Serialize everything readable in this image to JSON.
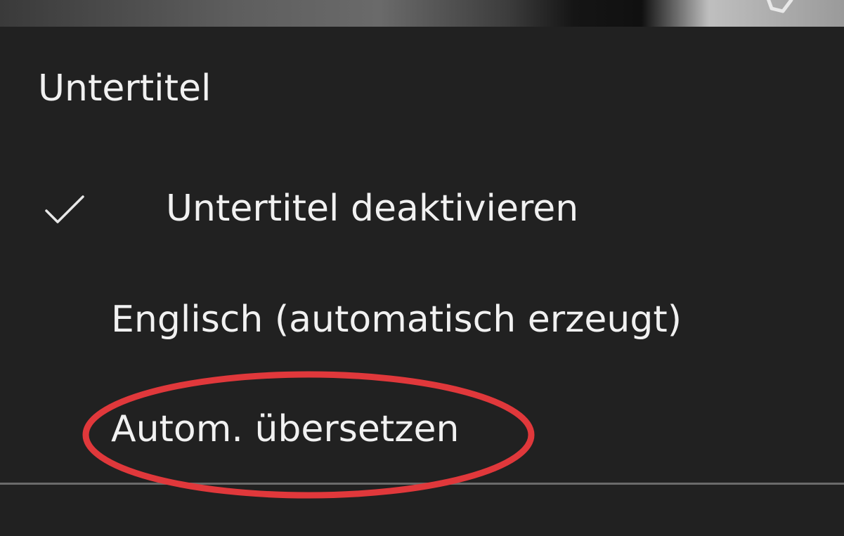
{
  "video": {
    "like_icon": "thumbs-up-icon"
  },
  "captions_sheet": {
    "title": "Untertitel",
    "items": [
      {
        "label": "Untertitel deaktivieren",
        "selected": true,
        "icon": "check-icon"
      },
      {
        "label": "Englisch (automatisch erzeugt)",
        "selected": false
      },
      {
        "label": "Autom. übersetzen",
        "selected": false,
        "highlighted": true
      }
    ],
    "annotation_color": "#e0383b"
  },
  "colors": {
    "sheet_background": "#212121",
    "text": "#f1f1f1",
    "divider": "#6b6b6b"
  }
}
